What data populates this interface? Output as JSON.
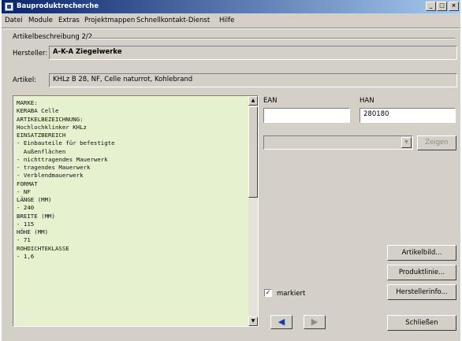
{
  "window": {
    "title": "Bauproduktrecherche",
    "controls": {
      "minimize": "_",
      "maximize": "□",
      "close": "×"
    }
  },
  "menu": [
    "Datei",
    "Module",
    "Extras",
    "Projektmappen",
    "Schnellkontakt-Dienst",
    "Hilfe"
  ],
  "section_title": "Artikelbeschreibung 2/2",
  "hersteller": {
    "label": "Hersteller:",
    "value": "A-K-A Ziegelwerke"
  },
  "artikel": {
    "label": "Artikel:",
    "value": "KHLz B 28, NF, Celle naturrot, Kohlebrand"
  },
  "description_lines": [
    "MARKE:",
    "KERABA Celle",
    "ARTIKELBEZEICHNUNG:",
    "Hochlochklinker KHLz",
    "EINSATZBEREICH",
    "- Einbauteile für befestigte",
    "  Außenflächen",
    "- nichttragendes Mauerwerk",
    "- tragendes Mauerwerk",
    "- Verblendmauerwerk",
    "FORMAT",
    "- NF",
    "LÄNGE (MM)",
    "- 240",
    "BREITE (MM)",
    "- 115",
    "HÖHE (MM)",
    "- 71",
    "ROHDICHTEKLASSE",
    "- 1,6"
  ],
  "ean": {
    "label": "EAN",
    "value": ""
  },
  "han": {
    "label": "HAN",
    "value": "280180"
  },
  "combo": {
    "value": "",
    "arrow": "▼"
  },
  "buttons": {
    "zeigen": "Zeigen",
    "artikelbild": "Artikelbild...",
    "produktlinie": "Produktlinie...",
    "herstellerinfo": "Herstellerinfo...",
    "schliessen": "Schließen"
  },
  "markiert": {
    "label": "markiert",
    "checked": true,
    "mark": "✓"
  },
  "nav": {
    "prev": "◀",
    "next": "▶"
  },
  "scroll": {
    "up": "▲",
    "down": "▼"
  },
  "colors": {
    "titlebar_start": "#0a246a",
    "titlebar_end": "#a6caf0",
    "listbox_bg": "#e5f1cf",
    "nav_active": "#1a3bb0"
  }
}
